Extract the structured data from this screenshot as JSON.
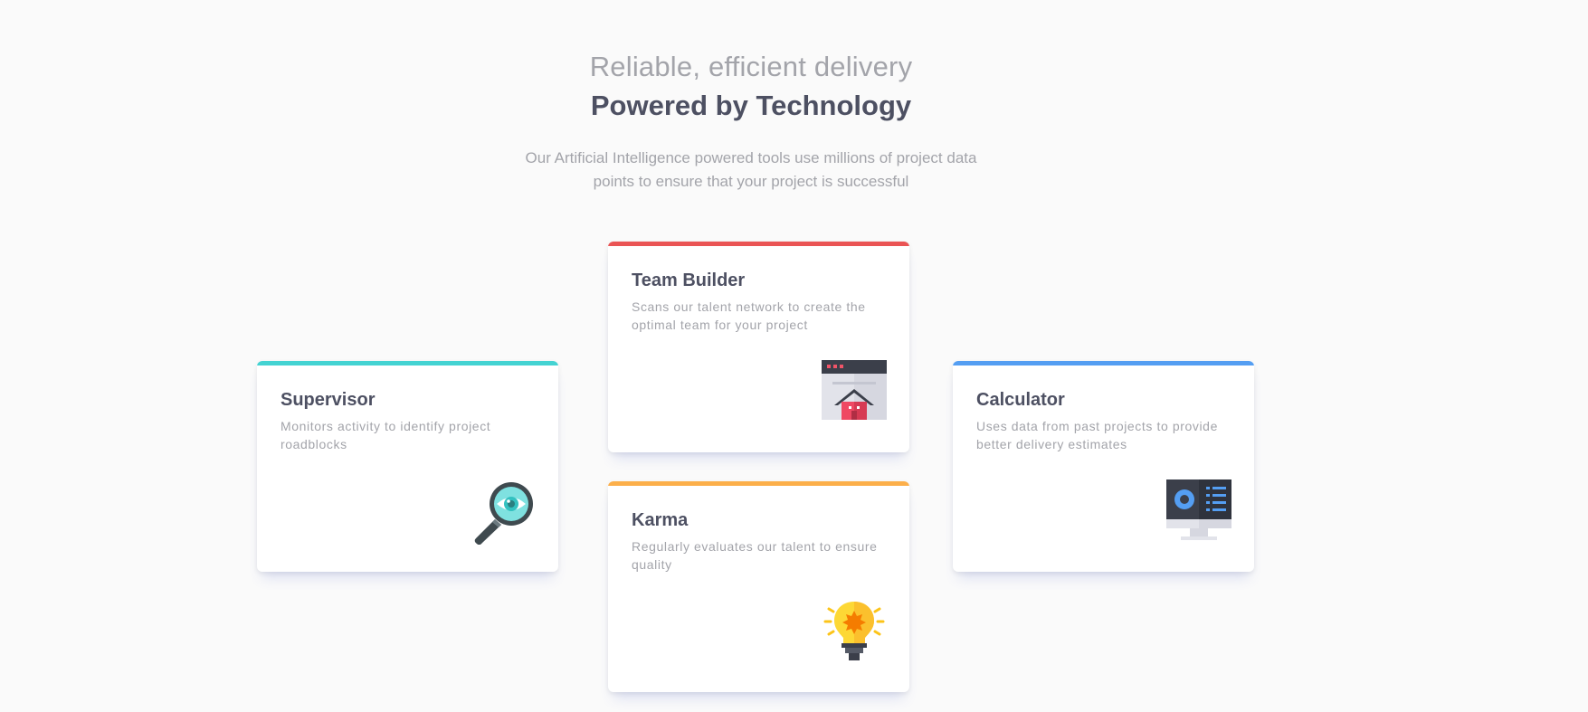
{
  "header": {
    "eyebrow": "Reliable, efficient delivery",
    "title": "Powered by Technology",
    "intro": "Our Artificial Intelligence powered tools use millions of project data points to ensure that your project is successful"
  },
  "cards": [
    {
      "id": "supervisor",
      "title": "Supervisor",
      "description": "Monitors activity to identify project roadblocks",
      "accent": "#44d3d2",
      "icon": "magnifier-eye-icon"
    },
    {
      "id": "team",
      "title": "Team Builder",
      "description": "Scans our talent network to create the optimal team for your project",
      "accent": "#ea5454",
      "icon": "browser-house-icon"
    },
    {
      "id": "karma",
      "title": "Karma",
      "description": "Regularly evaluates our talent to ensure quality",
      "accent": "#fcaf4a",
      "icon": "lightbulb-icon"
    },
    {
      "id": "calculator",
      "title": "Calculator",
      "description": "Uses data from past projects to provide better delivery estimates",
      "accent": "#549ef2",
      "icon": "monitor-dashboard-icon"
    }
  ]
}
